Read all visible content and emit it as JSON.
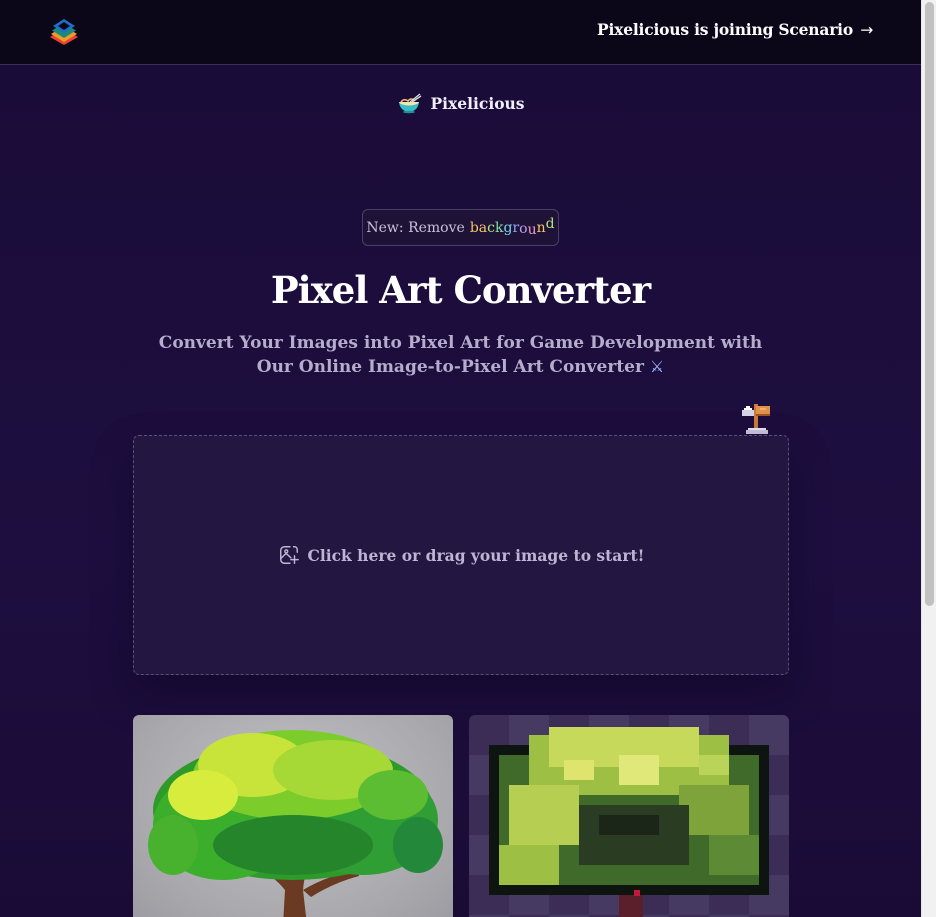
{
  "banner": {
    "announcement": "Pixelicious is joining Scenario",
    "arrow": "→"
  },
  "brand": {
    "name": "Pixelicious",
    "icon": "noodle-bowl-icon"
  },
  "badge": {
    "prefix": "New: Remove",
    "word_letters": [
      "b",
      "a",
      "c",
      "k",
      "g",
      "r",
      "o",
      "u",
      "n",
      "d"
    ],
    "word_colors": [
      "#f5c46a",
      "#f5c46a",
      "#b0e57c",
      "#7fe0a0",
      "#7fd4e8",
      "#8aa8f0",
      "#c49af0",
      "#f09ac8",
      "#f5c46a",
      "#b0e57c"
    ]
  },
  "hero": {
    "title": "Pixel Art Converter",
    "subtitle": "Convert Your Images into Pixel Art for Game Development with Our Online Image-to-Pixel Art Converter",
    "swords": "⚔"
  },
  "dropzone": {
    "label": "Click here or drag your image to start!",
    "icon": "image-add-icon"
  },
  "examples": {
    "original_icon": "tree-original-image",
    "pixel_icon": "tree-pixel-art-image"
  },
  "colors": {
    "background": "#1b0d3a",
    "topbar": "#0c0619",
    "dropzone": "#231640"
  }
}
